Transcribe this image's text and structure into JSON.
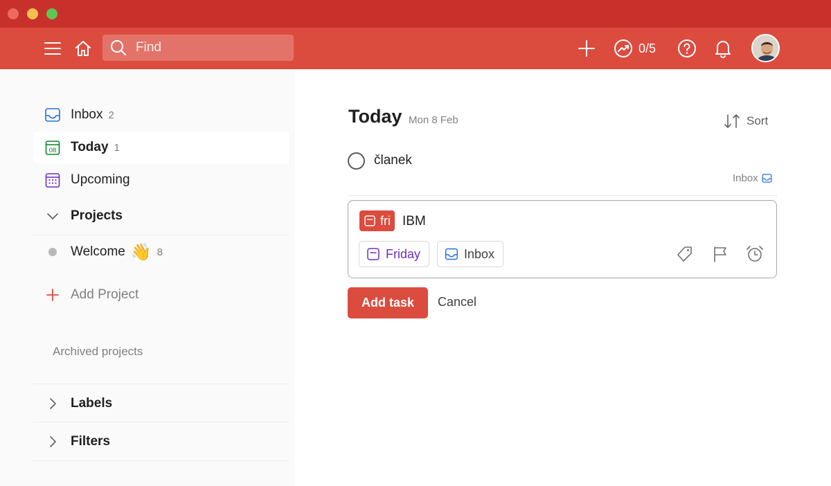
{
  "header": {
    "search_placeholder": "Find",
    "karma_progress": "0/5"
  },
  "sidebar": {
    "items": [
      {
        "label": "Inbox",
        "count": "2",
        "icon": "inbox-icon"
      },
      {
        "label": "Today",
        "count": "1",
        "icon": "calendar-today-icon",
        "day": "08"
      },
      {
        "label": "Upcoming",
        "icon": "calendar-grid-icon"
      }
    ],
    "projects_label": "Projects",
    "projects": [
      {
        "label": "Welcome",
        "emoji": "👋",
        "count": "8"
      }
    ],
    "add_project_label": "Add Project",
    "archived_label": "Archived projects",
    "labels_label": "Labels",
    "filters_label": "Filters"
  },
  "main": {
    "title": "Today",
    "date": "Mon 8 Feb",
    "sort_label": "Sort",
    "tasks": [
      {
        "text": "članek",
        "project": "Inbox"
      }
    ],
    "editor": {
      "date_chip": "fri",
      "text": "IBM",
      "due_label": "Friday",
      "project_label": "Inbox"
    },
    "add_task_label": "Add task",
    "cancel_label": "Cancel"
  },
  "colors": {
    "brand": "#db4c3f",
    "titlebar": "#c8302b",
    "upcoming": "#692fc2",
    "today": "#058527",
    "inbox": "#246fe0"
  }
}
